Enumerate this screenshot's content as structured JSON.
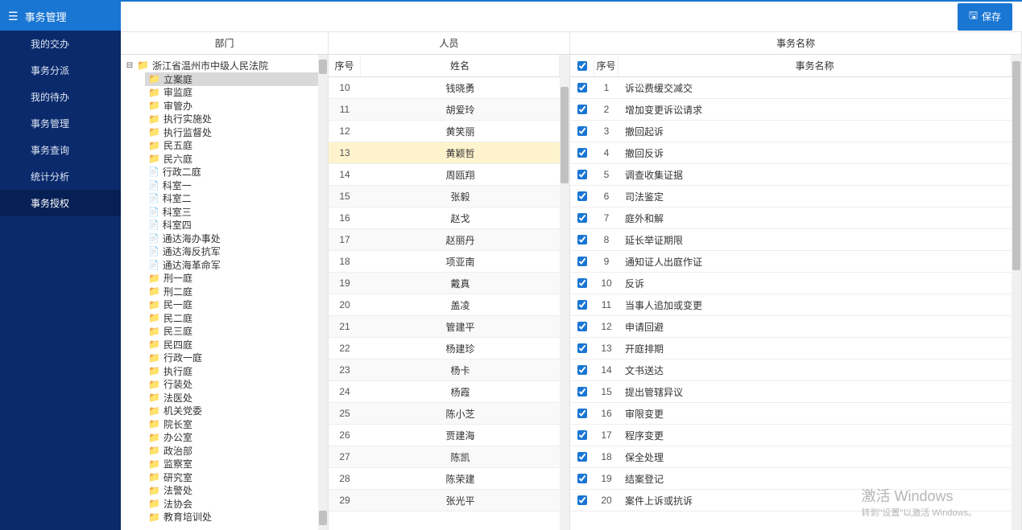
{
  "sidebar": {
    "title": "事务管理",
    "items": [
      {
        "label": "我的交办"
      },
      {
        "label": "事务分派"
      },
      {
        "label": "我的待办"
      },
      {
        "label": "事务管理"
      },
      {
        "label": "事务查询"
      },
      {
        "label": "统计分析"
      },
      {
        "label": "事务授权"
      }
    ],
    "active_index": 6
  },
  "toolbar": {
    "save_label": "保存"
  },
  "panels": {
    "dept_title": "部门",
    "person_title": "人员",
    "task_title": "事务名称"
  },
  "dept_tree": {
    "root": "浙江省温州市中级人民法院",
    "selected": "立案庭",
    "children": [
      {
        "label": "立案庭",
        "type": "folder"
      },
      {
        "label": "审监庭",
        "type": "folder"
      },
      {
        "label": "审管办",
        "type": "folder"
      },
      {
        "label": "执行实施处",
        "type": "folder"
      },
      {
        "label": "执行监督处",
        "type": "folder"
      },
      {
        "label": "民五庭",
        "type": "folder"
      },
      {
        "label": "民六庭",
        "type": "folder"
      },
      {
        "label": "行政二庭",
        "type": "file"
      },
      {
        "label": "科室一",
        "type": "file"
      },
      {
        "label": "科室二",
        "type": "file"
      },
      {
        "label": "科室三",
        "type": "file"
      },
      {
        "label": "科室四",
        "type": "file"
      },
      {
        "label": "通达海办事处",
        "type": "file"
      },
      {
        "label": "通达海反抗军",
        "type": "file"
      },
      {
        "label": "通达海革命军",
        "type": "file"
      },
      {
        "label": "刑一庭",
        "type": "folder"
      },
      {
        "label": "刑二庭",
        "type": "folder"
      },
      {
        "label": "民一庭",
        "type": "folder"
      },
      {
        "label": "民二庭",
        "type": "folder"
      },
      {
        "label": "民三庭",
        "type": "folder"
      },
      {
        "label": "民四庭",
        "type": "folder"
      },
      {
        "label": "行政一庭",
        "type": "folder"
      },
      {
        "label": "执行庭",
        "type": "folder"
      },
      {
        "label": "行装处",
        "type": "folder"
      },
      {
        "label": "法医处",
        "type": "folder"
      },
      {
        "label": "机关党委",
        "type": "folder"
      },
      {
        "label": "院长室",
        "type": "folder"
      },
      {
        "label": "办公室",
        "type": "folder"
      },
      {
        "label": "政治部",
        "type": "folder"
      },
      {
        "label": "监察室",
        "type": "folder"
      },
      {
        "label": "研究室",
        "type": "folder"
      },
      {
        "label": "法警处",
        "type": "folder"
      },
      {
        "label": "法协会",
        "type": "folder"
      },
      {
        "label": "教育培训处",
        "type": "folder"
      }
    ]
  },
  "person_grid": {
    "col_index": "序号",
    "col_name": "姓名",
    "highlight_index": 13,
    "rows": [
      {
        "idx": 10,
        "name": "钱晓勇"
      },
      {
        "idx": 11,
        "name": "胡爱玲"
      },
      {
        "idx": 12,
        "name": "黄笑丽"
      },
      {
        "idx": 13,
        "name": "黄颖哲"
      },
      {
        "idx": 14,
        "name": "周瓯翔"
      },
      {
        "idx": 15,
        "name": "张毅"
      },
      {
        "idx": 16,
        "name": "赵戈"
      },
      {
        "idx": 17,
        "name": "赵丽丹"
      },
      {
        "idx": 18,
        "name": "项亚南"
      },
      {
        "idx": 19,
        "name": "戴真"
      },
      {
        "idx": 20,
        "name": "盖凌"
      },
      {
        "idx": 21,
        "name": "管建平"
      },
      {
        "idx": 22,
        "name": "杨建珍"
      },
      {
        "idx": 23,
        "name": "杨卡"
      },
      {
        "idx": 24,
        "name": "杨霞"
      },
      {
        "idx": 25,
        "name": "陈小芝"
      },
      {
        "idx": 26,
        "name": "贾建海"
      },
      {
        "idx": 27,
        "name": "陈凯"
      },
      {
        "idx": 28,
        "name": "陈荣建"
      },
      {
        "idx": 29,
        "name": "张光平"
      }
    ]
  },
  "task_grid": {
    "col_index": "序号",
    "col_name": "事务名称",
    "rows": [
      {
        "idx": 1,
        "name": "诉讼费缓交减交"
      },
      {
        "idx": 2,
        "name": "增加变更诉讼请求"
      },
      {
        "idx": 3,
        "name": "撤回起诉"
      },
      {
        "idx": 4,
        "name": "撤回反诉"
      },
      {
        "idx": 5,
        "name": "调查收集证据"
      },
      {
        "idx": 6,
        "name": "司法鉴定"
      },
      {
        "idx": 7,
        "name": "庭外和解"
      },
      {
        "idx": 8,
        "name": "延长举证期限"
      },
      {
        "idx": 9,
        "name": "通知证人出庭作证"
      },
      {
        "idx": 10,
        "name": "反诉"
      },
      {
        "idx": 11,
        "name": "当事人追加或变更"
      },
      {
        "idx": 12,
        "name": "申请回避"
      },
      {
        "idx": 13,
        "name": "开庭排期"
      },
      {
        "idx": 14,
        "name": "文书送达"
      },
      {
        "idx": 15,
        "name": "提出管辖异议"
      },
      {
        "idx": 16,
        "name": "审限变更"
      },
      {
        "idx": 17,
        "name": "程序变更"
      },
      {
        "idx": 18,
        "name": "保全处理"
      },
      {
        "idx": 19,
        "name": "结案登记"
      },
      {
        "idx": 20,
        "name": "案件上诉或抗诉"
      }
    ]
  },
  "watermark": {
    "line1": "激活 Windows",
    "line2": "转到\"设置\"以激活 Windows。"
  }
}
